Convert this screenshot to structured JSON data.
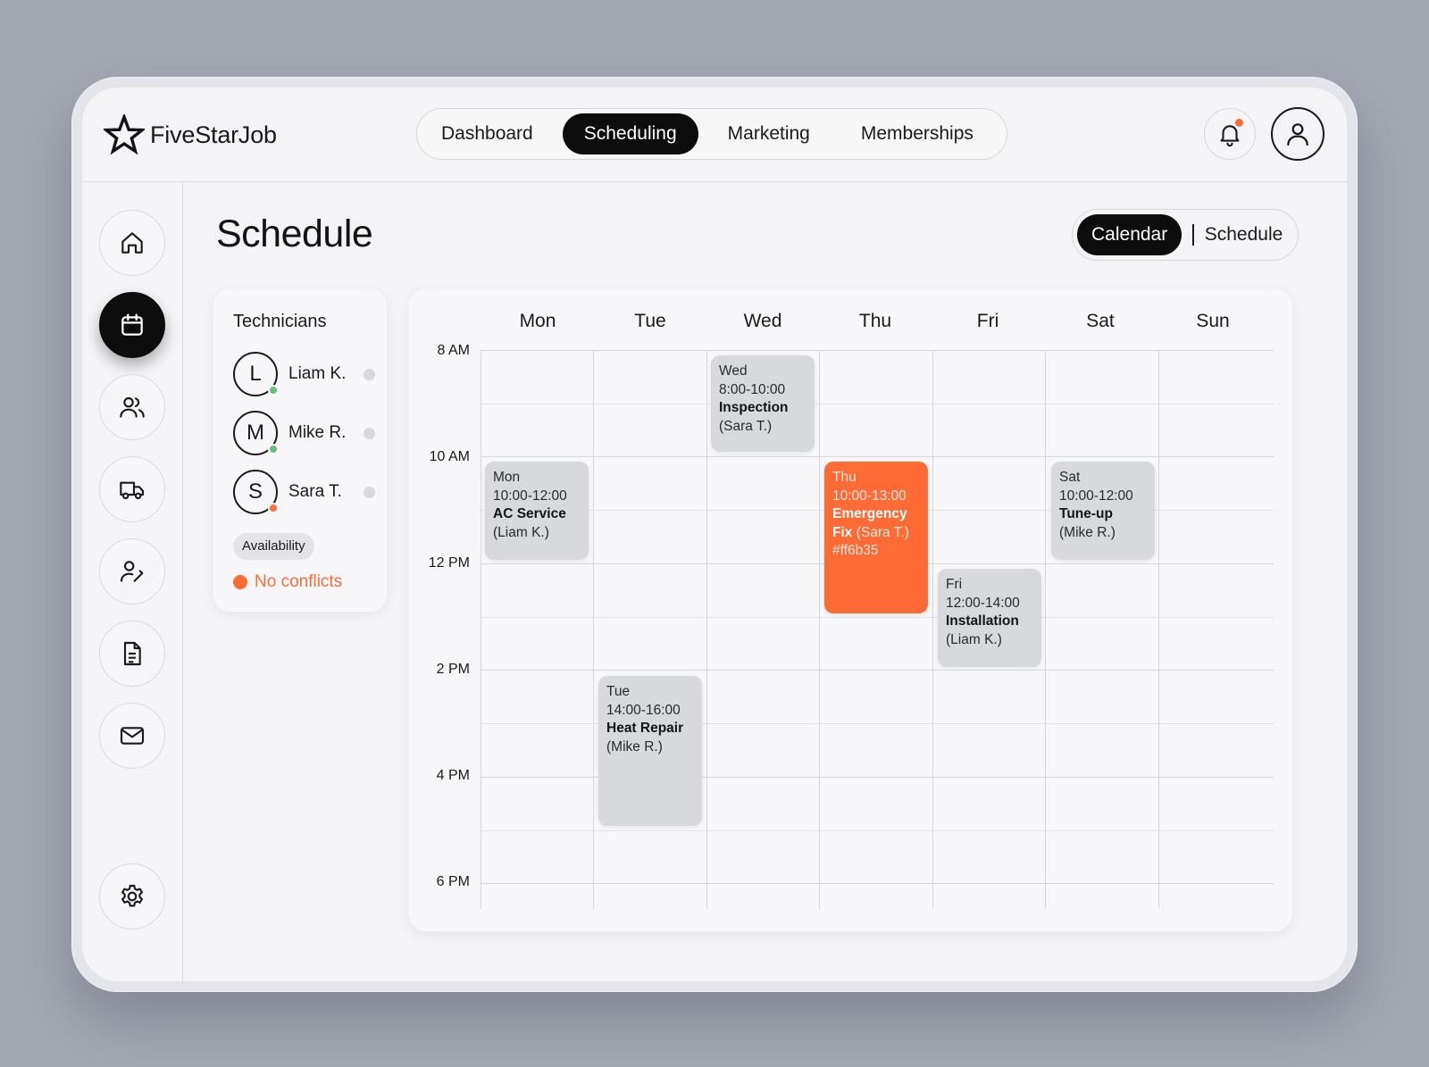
{
  "brand": {
    "name": "FiveStarJob"
  },
  "nav": {
    "items": [
      {
        "label": "Dashboard",
        "active": false
      },
      {
        "label": "Scheduling",
        "active": true
      },
      {
        "label": "Marketing",
        "active": false
      },
      {
        "label": "Memberships",
        "active": false
      }
    ]
  },
  "header": {
    "notification_icon": "bell-icon",
    "notification_badge_color": "#ff6b35",
    "profile_icon": "user-icon"
  },
  "sidebar": {
    "items": [
      {
        "icon": "home-icon",
        "active": false
      },
      {
        "icon": "calendar-icon",
        "active": true
      },
      {
        "icon": "users-icon",
        "active": false
      },
      {
        "icon": "truck-icon",
        "active": false
      },
      {
        "icon": "user-edit-icon",
        "active": false
      },
      {
        "icon": "document-icon",
        "active": false
      },
      {
        "icon": "mail-icon",
        "active": false
      },
      {
        "icon": "gear-icon",
        "active": false
      }
    ]
  },
  "page": {
    "title": "Schedule"
  },
  "view_toggle": {
    "calendar": "Calendar",
    "schedule": "Schedule",
    "active": "Calendar"
  },
  "technicians": {
    "title": "Technicians",
    "list": [
      {
        "initial": "L",
        "name": "Liam K.",
        "status_color": "#6cba7d"
      },
      {
        "initial": "M",
        "name": "Mike R.",
        "status_color": "#6cba7d"
      },
      {
        "initial": "S",
        "name": "Sara T.",
        "status_color": "#ff6b35"
      }
    ],
    "availability_label": "Availability",
    "conflicts_label": "No conflicts"
  },
  "calendar": {
    "days": [
      "Mon",
      "Tue",
      "Wed",
      "Thu",
      "Fri",
      "Sat",
      "Sun"
    ],
    "times": [
      "8 AM",
      "10 AM",
      "12 PM",
      "2 PM",
      "4 PM",
      "6 PM"
    ],
    "events": [
      {
        "day": "Wed",
        "time": "8:00-10:00",
        "title": "Inspection",
        "tech": "(Sara T.)",
        "note": ""
      },
      {
        "day": "Mon",
        "time": "10:00-12:00",
        "title": "AC Service",
        "tech": "(Liam K.)",
        "note": ""
      },
      {
        "day": "Thu",
        "time": "10:00-13:00",
        "title_line1": "Emergency",
        "title_line2": "Fix",
        "tech": "(Sara T.)",
        "note": "#ff6b35",
        "highlight": true
      },
      {
        "day": "Sat",
        "time": "10:00-12:00",
        "title": "Tune-up",
        "tech": "(Mike R.)",
        "note": ""
      },
      {
        "day": "Fri",
        "time": "12:00-14:00",
        "title": "Installation",
        "tech": "(Liam K.)",
        "note": ""
      },
      {
        "day": "Tue",
        "time": "14:00-16:00",
        "title": "Heat Repair",
        "tech": "(Mike R.)",
        "note": ""
      }
    ]
  }
}
